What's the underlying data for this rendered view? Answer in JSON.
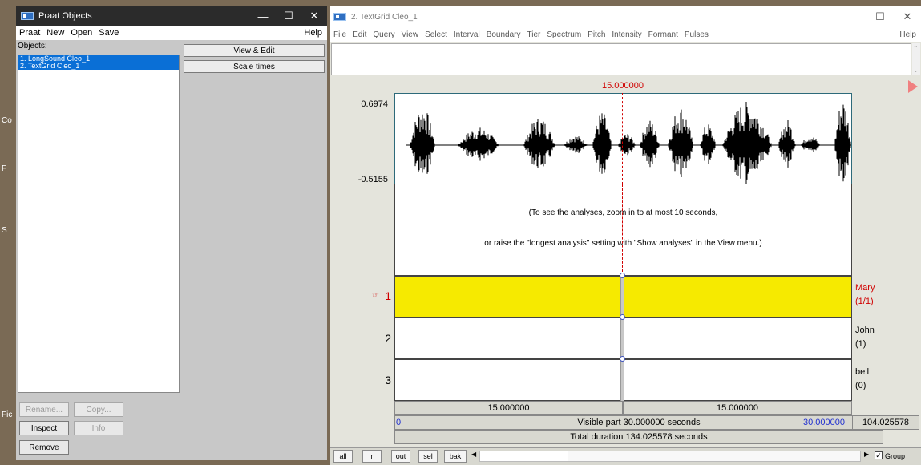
{
  "objects_window": {
    "title": "Praat Objects",
    "menu": [
      "Praat",
      "New",
      "Open",
      "Save"
    ],
    "help": "Help",
    "objects_label": "Objects:",
    "objects": [
      "1. LongSound Cleo_1",
      "2. TextGrid Cleo_1"
    ],
    "buttons": {
      "view_edit": "View & Edit",
      "scale_times": "Scale times",
      "rename": "Rename...",
      "copy": "Copy...",
      "inspect": "Inspect",
      "info": "Info",
      "remove": "Remove"
    }
  },
  "background_hints": [
    "Co",
    "F",
    "S",
    "Fic"
  ],
  "editor": {
    "title": "2. TextGrid Cleo_1",
    "menu": [
      "File",
      "Edit",
      "Query",
      "View",
      "Select",
      "Interval",
      "Boundary",
      "Tier",
      "Spectrum",
      "Pitch",
      "Intensity",
      "Formant",
      "Pulses"
    ],
    "help": "Help",
    "cursor_time": "15.000000",
    "y_max": "0.6974",
    "y_min": "-0.5155",
    "analysis_msg1": "(To see the analyses, zoom in to at most 10 seconds,",
    "analysis_msg2": "or raise the \"longest analysis\" setting with \"Show analyses\" in the View menu.)",
    "tiers": [
      {
        "num": "1",
        "name": "Mary",
        "count": "(1/1)"
      },
      {
        "num": "2",
        "name": "John",
        "count": "(1)"
      },
      {
        "num": "3",
        "name": "bell",
        "count": "(0)"
      }
    ],
    "left_interval": "15.000000",
    "right_interval": "15.000000",
    "visible_start": "0",
    "visible_part": "Visible part 30.000000 seconds",
    "visible_end": "30.000000",
    "total_end": "104.025578",
    "total_duration": "Total duration 134.025578 seconds",
    "nav_buttons": [
      "all",
      "in",
      "out",
      "sel",
      "bak"
    ],
    "group_label": "Group",
    "group_checked": true
  },
  "colors": {
    "selected_tier": "#f6ea00",
    "cursor": "#d00000",
    "list_selection": "#0a6fd6"
  }
}
